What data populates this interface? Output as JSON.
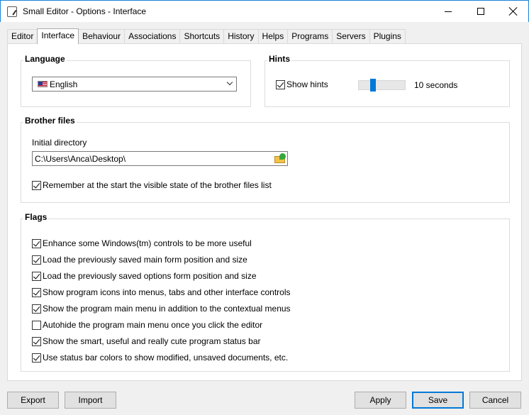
{
  "window": {
    "title": "Small Editor - Options - Interface"
  },
  "tabs": [
    {
      "label": "Editor",
      "active": false
    },
    {
      "label": "Interface",
      "active": true
    },
    {
      "label": "Behaviour",
      "active": false
    },
    {
      "label": "Associations",
      "active": false
    },
    {
      "label": "Shortcuts",
      "active": false
    },
    {
      "label": "History",
      "active": false
    },
    {
      "label": "Helps",
      "active": false
    },
    {
      "label": "Programs",
      "active": false
    },
    {
      "label": "Servers",
      "active": false
    },
    {
      "label": "Plugins",
      "active": false
    }
  ],
  "language": {
    "heading": "Language",
    "selected": "English"
  },
  "hints": {
    "heading": "Hints",
    "show_hints_label": "Show hints",
    "show_hints_checked": true,
    "duration_text": "10 seconds",
    "slider_value_seconds": 10
  },
  "brother_files": {
    "heading": "Brother files",
    "initial_directory_label": "Initial directory",
    "initial_directory_value": "C:\\Users\\Anca\\Desktop\\",
    "remember_label": "Remember at the start the visible state of the brother files list",
    "remember_checked": true
  },
  "flags": {
    "heading": "Flags",
    "items": [
      {
        "label": "Enhance some Windows(tm) controls to be more useful",
        "checked": true
      },
      {
        "label": "Load the previously saved main form position and size",
        "checked": true
      },
      {
        "label": "Load the previously saved options form position and size",
        "checked": true
      },
      {
        "label": "Show program icons into menus, tabs and other interface controls",
        "checked": true
      },
      {
        "label": "Show the program main menu in addition to the contextual menus",
        "checked": true
      },
      {
        "label": "Autohide the program main menu once you click the editor",
        "checked": false
      },
      {
        "label": "Show the smart, useful and really cute program status bar",
        "checked": true
      },
      {
        "label": "Use status bar colors to show modified, unsaved documents, etc.",
        "checked": true
      }
    ]
  },
  "buttons": {
    "export": "Export",
    "import": "Import",
    "apply": "Apply",
    "save": "Save",
    "cancel": "Cancel"
  }
}
